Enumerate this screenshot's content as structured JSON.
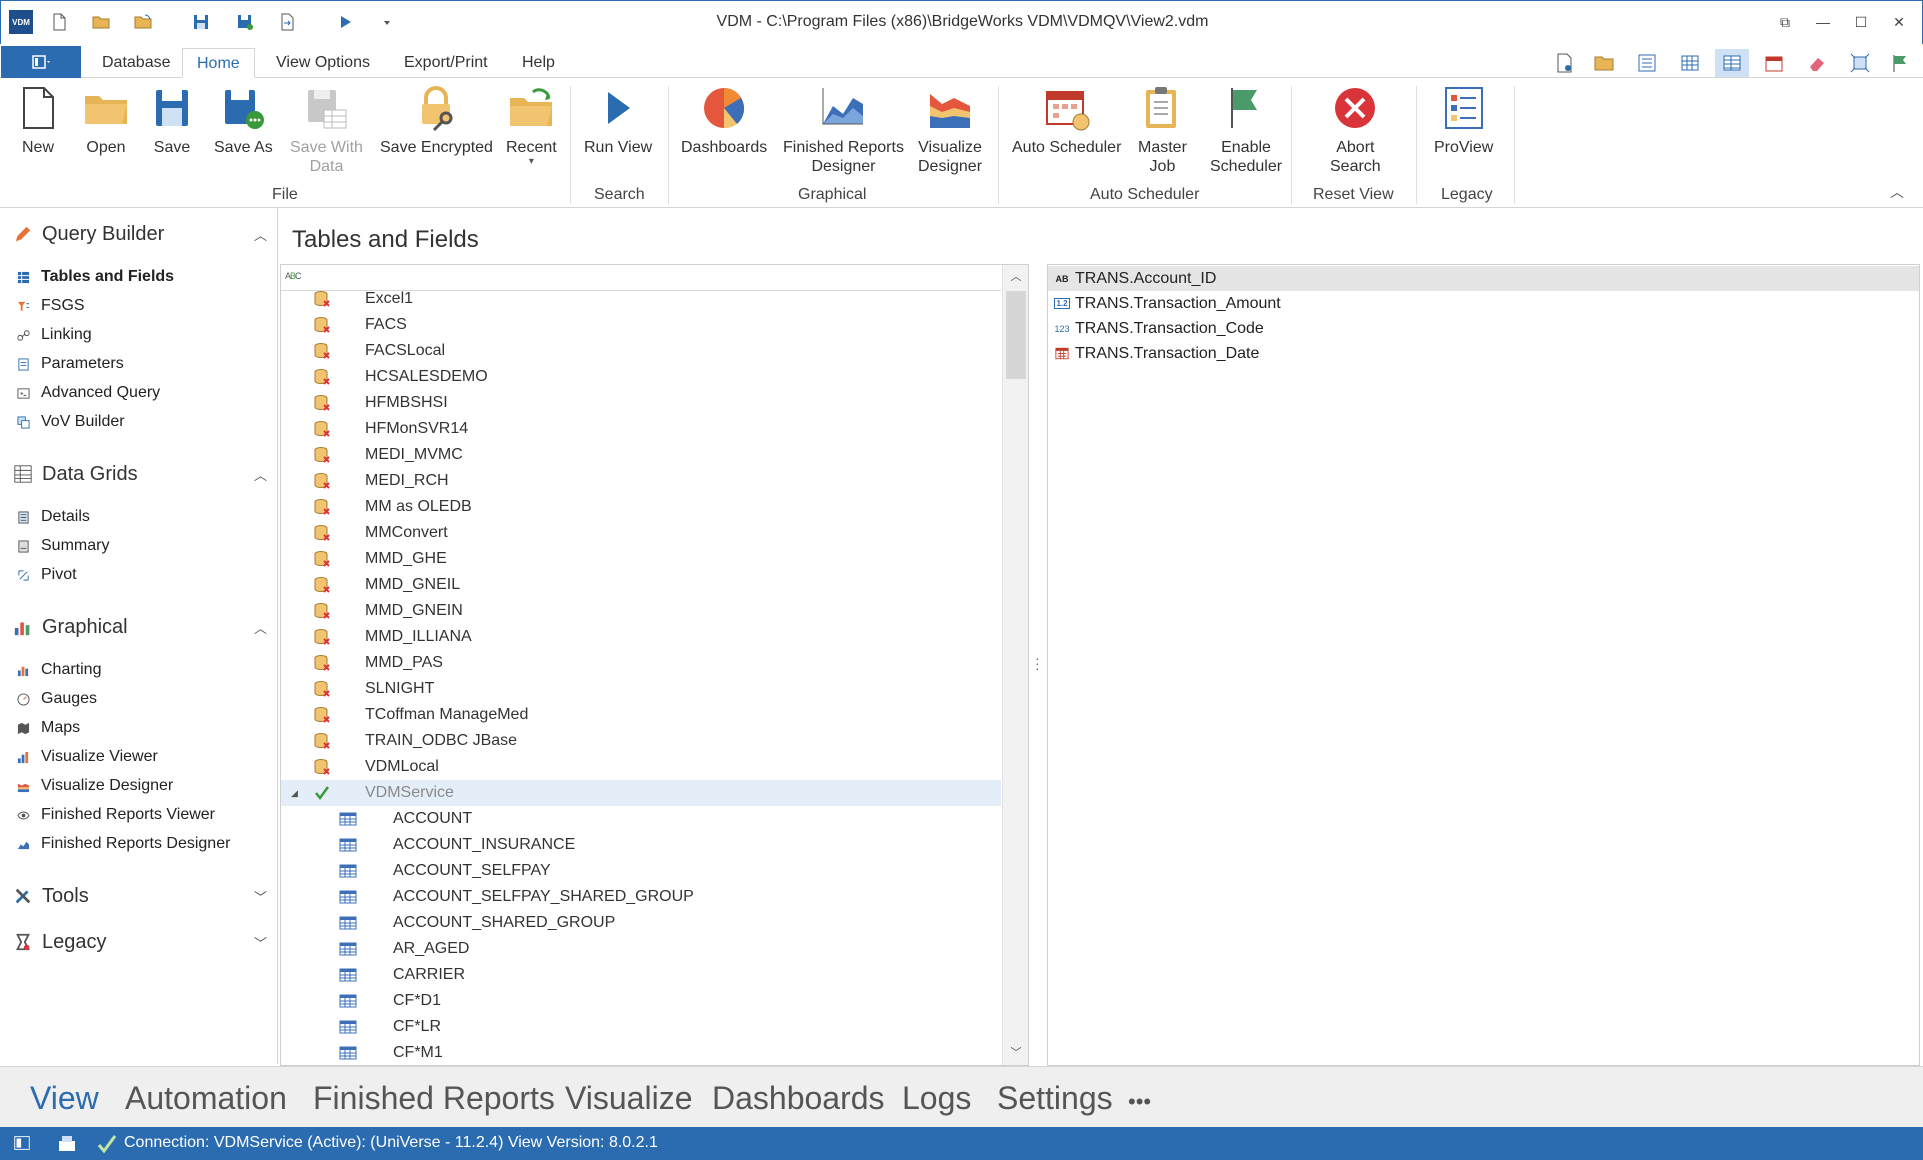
{
  "window": {
    "title": "VDM - C:\\Program Files (x86)\\BridgeWorks VDM\\VDMQV\\View2.vdm",
    "logo_text": "VDM"
  },
  "ribbon_tabs": [
    {
      "label": "Database",
      "active": false
    },
    {
      "label": "Home",
      "active": true
    },
    {
      "label": "View Options",
      "active": false
    },
    {
      "label": "Export/Print",
      "active": false
    },
    {
      "label": "Help",
      "active": false
    }
  ],
  "ribbon": {
    "new": "New",
    "open": "Open",
    "save": "Save",
    "save_as": "Save As",
    "save_with_data_1": "Save With",
    "save_with_data_2": "Data",
    "save_encrypted": "Save Encrypted",
    "recent": "Recent",
    "run_view": "Run View",
    "dashboards": "Dashboards",
    "finished_reports_designer_1": "Finished Reports",
    "finished_reports_designer_2": "Designer",
    "visualize_designer_1": "Visualize",
    "visualize_designer_2": "Designer",
    "auto_scheduler": "Auto Scheduler",
    "master_job_1": "Master",
    "master_job_2": "Job",
    "enable_scheduler_1": "Enable",
    "enable_scheduler_2": "Scheduler",
    "abort_search_1": "Abort",
    "abort_search_2": "Search",
    "proview": "ProView",
    "groups": {
      "file": "File",
      "search": "Search",
      "graphical": "Graphical",
      "auto_scheduler": "Auto Scheduler",
      "reset_view": "Reset View",
      "legacy": "Legacy"
    }
  },
  "sidebar": {
    "query_builder": {
      "title": "Query Builder",
      "items": [
        "Tables and Fields",
        "FSGS",
        "Linking",
        "Parameters",
        "Advanced Query",
        "VoV Builder"
      ]
    },
    "data_grids": {
      "title": "Data Grids",
      "items": [
        "Details",
        "Summary",
        "Pivot"
      ]
    },
    "graphical": {
      "title": "Graphical",
      "items": [
        "Charting",
        "Gauges",
        "Maps",
        "Visualize Viewer",
        "Visualize Designer",
        "Finished Reports Viewer",
        "Finished Reports Designer"
      ]
    },
    "tools": {
      "title": "Tools"
    },
    "legacy": {
      "title": "Legacy"
    }
  },
  "main": {
    "title": "Tables and Fields",
    "connections": [
      "Excel1",
      "FACS",
      "FACSLocal",
      "HCSALESDEMO",
      "HFMBSHSI",
      "HFMonSVR14",
      "MEDI_MVMC",
      "MEDI_RCH",
      "MM as OLEDB",
      "MMConvert",
      "MMD_GHE",
      "MMD_GNEIL",
      "MMD_GNEIN",
      "MMD_ILLIANA",
      "MMD_PAS",
      "SLNIGHT",
      "TCoffman ManageMed",
      "TRAIN_ODBC JBase",
      "VDMLocal"
    ],
    "active_connection": "VDMService",
    "tables": [
      "ACCOUNT",
      "ACCOUNT_INSURANCE",
      "ACCOUNT_SELFPAY",
      "ACCOUNT_SELFPAY_SHARED_GROUP",
      "ACCOUNT_SHARED_GROUP",
      "AR_AGED",
      "CARRIER",
      "CF*D1",
      "CF*LR",
      "CF*M1"
    ],
    "fields": [
      {
        "label": "TRANS.Account_ID",
        "type_glyph": "AB",
        "icon": "text-field-icon"
      },
      {
        "label": "TRANS.Transaction_Amount",
        "type_glyph": "1.2",
        "icon": "decimal-field-icon"
      },
      {
        "label": "TRANS.Transaction_Code",
        "type_glyph": "123",
        "icon": "integer-field-icon"
      },
      {
        "label": "TRANS.Transaction_Date",
        "type_glyph": "",
        "icon": "date-field-icon"
      }
    ]
  },
  "bottom_nav": [
    "View",
    "Automation",
    "Finished Reports",
    "Visualize",
    "Dashboards",
    "Logs",
    "Settings",
    "•••"
  ],
  "status": {
    "text": "Connection: VDMService (Active): (UniVerse - 11.2.4) View Version: 8.0.2.1"
  },
  "colors": {
    "accent": "#2b6cb0",
    "ok_check": "#3a9a3a",
    "error_x": "#d9343a"
  }
}
